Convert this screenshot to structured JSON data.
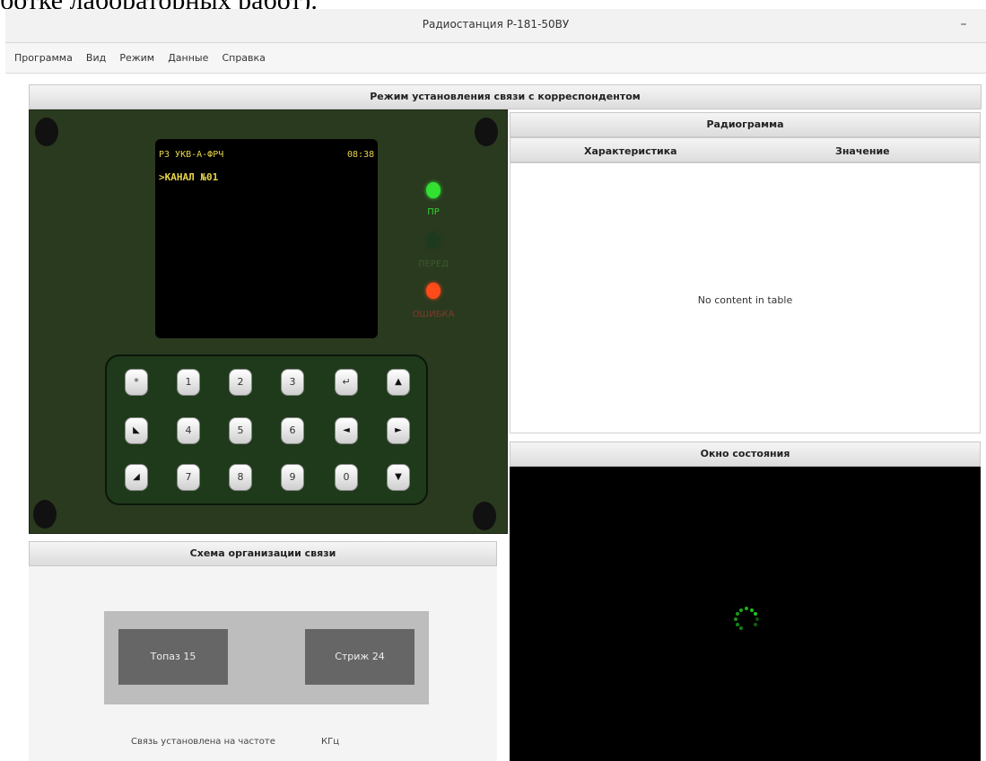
{
  "doc_fragment": "ботке лабораторных работ).",
  "window": {
    "title": "Радиостанция Р-181-50ВУ",
    "minimize_glyph": "–"
  },
  "menu": [
    "Программа",
    "Вид",
    "Режим",
    "Данные",
    "Справка"
  ],
  "main_panel": {
    "title": "Режим установления связи с корреспондентом"
  },
  "device": {
    "lcd": {
      "header": "РЗ УКВ-А-ФРЧ",
      "time": "08:38",
      "line2": ">КАНАЛ №01"
    },
    "leds": [
      {
        "label": "ПР",
        "color": "#32e132",
        "label_color": "#32d232"
      },
      {
        "label": "ПЕРЕД",
        "color": "#1e3a1e",
        "label_color": "#3a5a2a"
      },
      {
        "label": "ОШИБКА",
        "color": "#ff4a1a",
        "label_color": "#7a3a2a"
      }
    ],
    "keypad": [
      [
        "*",
        "1",
        "2",
        "3",
        "↵",
        "▲"
      ],
      [
        "◣",
        "4",
        "5",
        "6",
        "◄",
        "►"
      ],
      [
        "◢",
        "7",
        "8",
        "9",
        "0",
        "▼"
      ]
    ]
  },
  "schema": {
    "title": "Схема организации связи",
    "node_left": "Топаз 15",
    "node_right": "Стриж 24",
    "status_text": "Связь установлена на частоте",
    "unit": "КГц"
  },
  "radiogram": {
    "title": "Радиограмма",
    "columns": [
      "Характеристика",
      "Значение"
    ],
    "empty_text": "No content in table"
  },
  "status_window": {
    "title": "Окно состояния",
    "spinner_color": "#1fd023"
  }
}
